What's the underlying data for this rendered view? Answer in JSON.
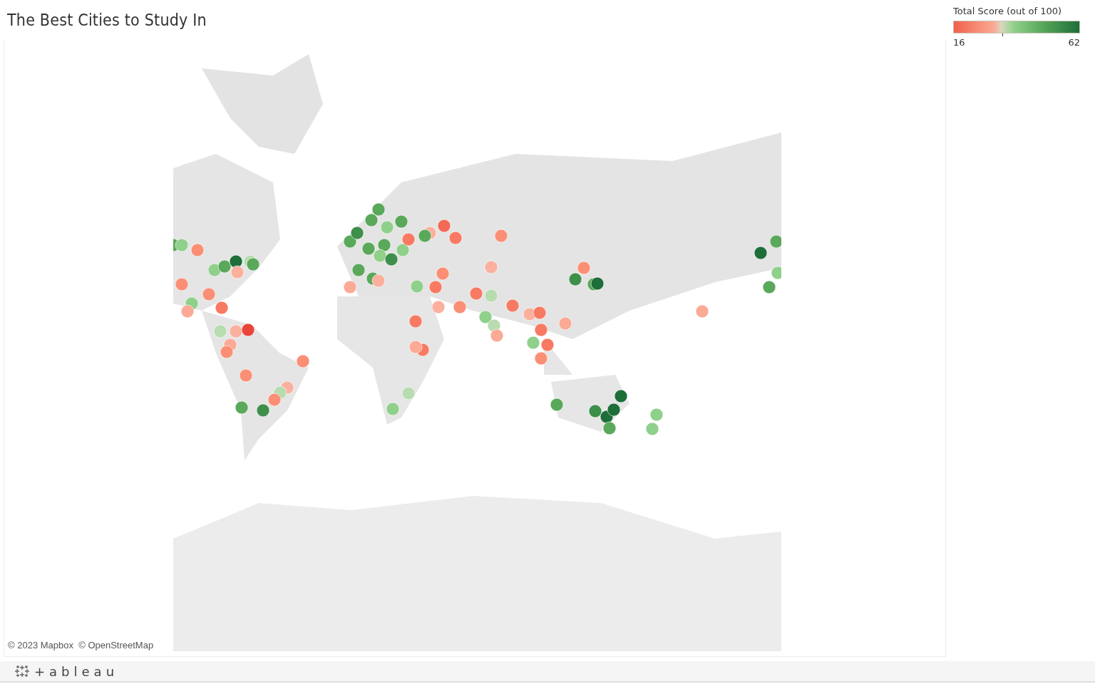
{
  "title": "The Best Cities to Study In",
  "map": {
    "kind": "picture",
    "attribution": "© 2023 Mapbox  © OpenStreetMap"
  },
  "legend": {
    "title": "Total Score (out of 100)",
    "min": "16",
    "max": "62"
  },
  "footer": {
    "logo": "+ableau"
  }
}
